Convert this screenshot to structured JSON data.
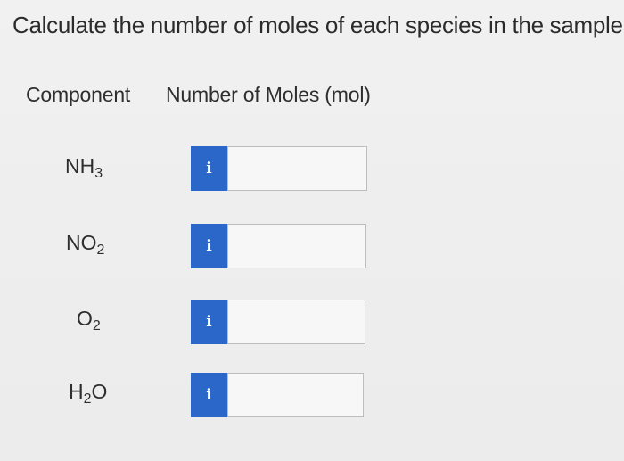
{
  "question": "Calculate the number of moles of each species in the sample.",
  "table": {
    "header_component": "Component",
    "header_moles": "Number of Moles (mol)",
    "rows": [
      {
        "base": "NH",
        "sub": "3",
        "tail": "",
        "info_glyph": "i",
        "value": ""
      },
      {
        "base": "NO",
        "sub": "2",
        "tail": "",
        "info_glyph": "i",
        "value": ""
      },
      {
        "base": "O",
        "sub": "2",
        "tail": "",
        "info_glyph": "i",
        "value": ""
      },
      {
        "base": "H",
        "sub": "2",
        "tail": "O",
        "info_glyph": "i",
        "value": ""
      }
    ]
  },
  "colors": {
    "info_button": "#2a67c9",
    "background": "#efefef",
    "input_border": "#bdbdbd"
  }
}
